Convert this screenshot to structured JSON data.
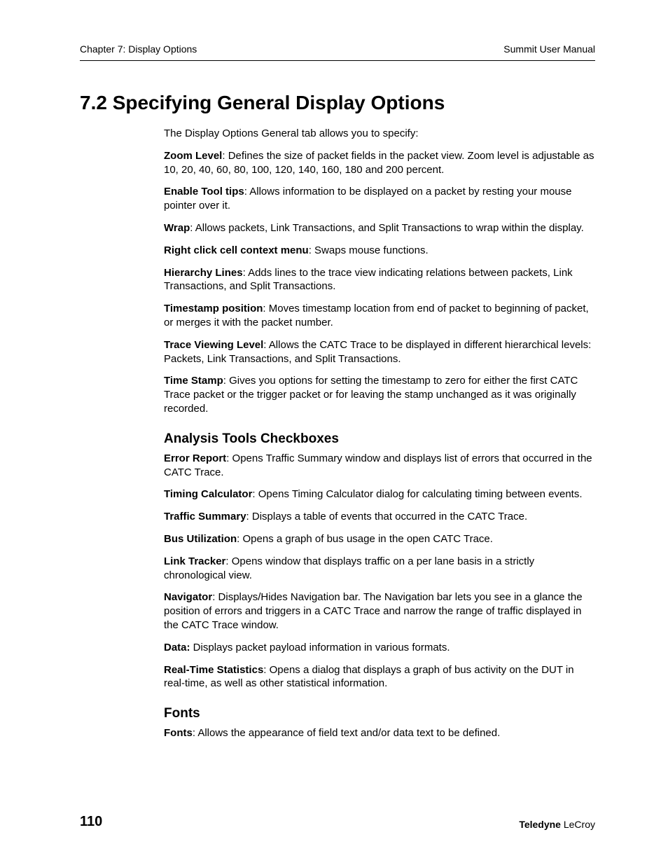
{
  "header": {
    "left": "Chapter 7: Display Options",
    "right": "Summit User Manual"
  },
  "title": "7.2 Specifying General Display Options",
  "intro": "The Display Options General tab allows you to specify:",
  "general": [
    {
      "term": "Zoom Level",
      "desc": ": Defines the size of packet fields in the packet view. Zoom level is adjustable as 10, 20, 40, 60, 80, 100, 120, 140, 160, 180 and 200 percent."
    },
    {
      "term": "Enable Tool tips",
      "desc": ": Allows information to be displayed on a packet by resting your mouse pointer over it."
    },
    {
      "term": "Wrap",
      "desc": ": Allows packets, Link Transactions, and Split Transactions to wrap within the display."
    },
    {
      "term": "Right click cell context menu",
      "desc": ": Swaps mouse functions."
    },
    {
      "term": "Hierarchy Lines",
      "desc": ": Adds lines to the trace view indicating relations between packets, Link Transactions, and Split Transactions."
    },
    {
      "term": "Timestamp position",
      "desc": ": Moves timestamp location from end of packet to beginning of packet, or merges it with the packet number."
    },
    {
      "term": "Trace Viewing Level",
      "desc": ": Allows the CATC Trace to be displayed in different hierarchical levels: Packets, Link Transactions, and Split Transactions."
    },
    {
      "term": "Time Stamp",
      "desc": ": Gives you options for setting the timestamp to zero for either the first CATC Trace packet or the trigger packet or for leaving the stamp unchanged as it was originally recorded."
    }
  ],
  "analysis_heading": "Analysis Tools Checkboxes",
  "analysis": [
    {
      "term": "Error Report",
      "desc": ": Opens Traffic Summary window and displays list of errors that occurred in the CATC Trace."
    },
    {
      "term": "Timing Calculator",
      "desc": ": Opens Timing Calculator dialog for calculating timing between events."
    },
    {
      "term": "Traffic Summary",
      "desc": ": Displays a table of events that occurred in the CATC Trace."
    },
    {
      "term": "Bus Utilization",
      "desc": ": Opens a graph of bus usage in the open CATC Trace."
    },
    {
      "term": "Link Tracker",
      "desc": ": Opens window that displays traffic on a per lane basis in a strictly chronological view."
    },
    {
      "term": "Navigator",
      "desc": ": Displays/Hides Navigation bar. The Navigation bar lets you see in a glance the position of errors and triggers in a CATC Trace and narrow the range of traffic displayed in the CATC Trace window."
    },
    {
      "term": "Data:",
      "desc": " Displays packet payload information in various formats."
    },
    {
      "term": "Real-Time Statistics",
      "desc": ": Opens a dialog that displays a graph of bus activity on the DUT in real-time, as well as other statistical information."
    }
  ],
  "fonts_heading": "Fonts",
  "fonts": [
    {
      "term": "Fonts",
      "desc": ": Allows the appearance of field text and/or data text to be defined."
    }
  ],
  "footer": {
    "page": "110",
    "brand_bold": "Teledyne",
    "brand_rest": " LeCroy"
  }
}
